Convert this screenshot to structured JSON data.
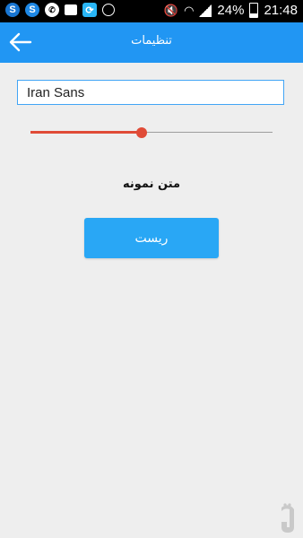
{
  "status_bar": {
    "battery": "24%",
    "time": "21:48"
  },
  "app_bar": {
    "title": "تنظیمات"
  },
  "font_field": {
    "value": "Iran Sans"
  },
  "font_size_slider": {
    "value_fraction": 0.46
  },
  "sample": {
    "text": "متن نمونه"
  },
  "reset_button": {
    "label": "ریست"
  },
  "colors": {
    "app_bar": "#2196f3",
    "accent": "#e04b37",
    "button": "#29a7f5",
    "background": "#eeeeee"
  }
}
